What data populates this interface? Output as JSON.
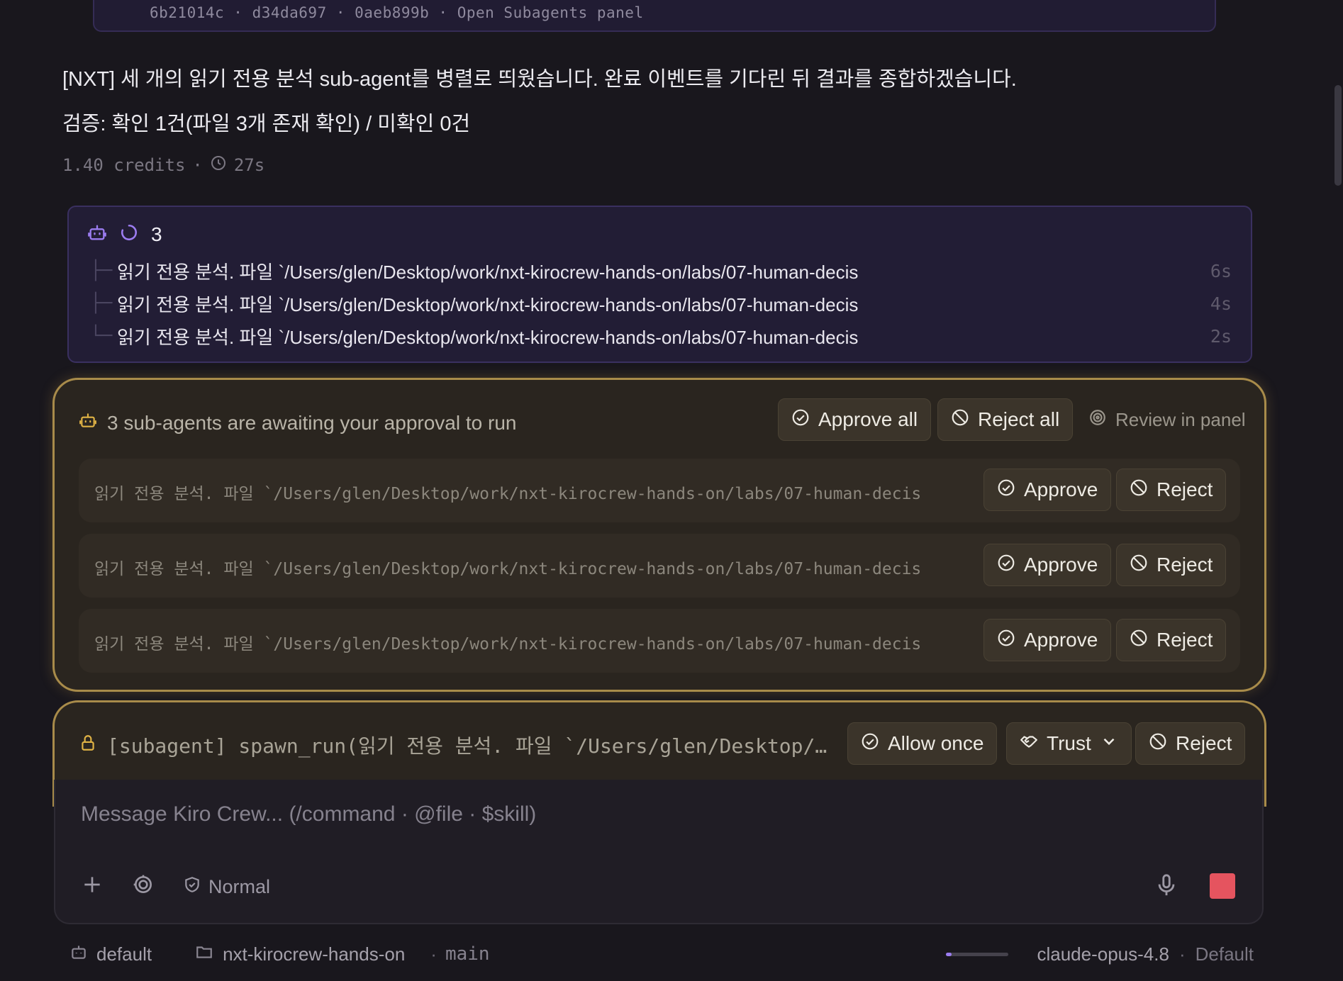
{
  "top_card": {
    "line": "6b21014c · d34da697 · 0aeb899b · Open Subagents panel"
  },
  "messages": {
    "line1": "[NXT] 세 개의 읽기 전용 분석 sub-agent를 병렬로 띄웠습니다. 완료 이벤트를 기다린 뒤 결과를 종합하겠습니다.",
    "line2": "검증: 확인 1건(파일 3개 존재 확인) / 미확인 0건",
    "credits": "1.40 credits",
    "sep": "·",
    "time": "27s"
  },
  "running": {
    "count": "3",
    "rows": [
      {
        "tree": "├─",
        "text": "읽기 전용 분석. 파일 `/Users/glen/Desktop/work/nxt-kirocrew-hands-on/labs/07-human-decis",
        "duration": "6s"
      },
      {
        "tree": "├─",
        "text": "읽기 전용 분석. 파일 `/Users/glen/Desktop/work/nxt-kirocrew-hands-on/labs/07-human-decis",
        "duration": "4s"
      },
      {
        "tree": "└─",
        "text": "읽기 전용 분석. 파일 `/Users/glen/Desktop/work/nxt-kirocrew-hands-on/labs/07-human-decis",
        "duration": "2s"
      }
    ]
  },
  "approval": {
    "title": "3 sub-agents are awaiting your approval to run",
    "approve_all": "Approve all",
    "reject_all": "Reject all",
    "review": "Review in panel",
    "rows": [
      {
        "text": "읽기 전용 분석. 파일 `/Users/glen/Desktop/work/nxt-kirocrew-hands-on/labs/07-human-decis",
        "approve": "Approve",
        "reject": "Reject"
      },
      {
        "text": "읽기 전용 분석. 파일 `/Users/glen/Desktop/work/nxt-kirocrew-hands-on/labs/07-human-decis",
        "approve": "Approve",
        "reject": "Reject"
      },
      {
        "text": "읽기 전용 분석. 파일 `/Users/glen/Desktop/work/nxt-kirocrew-hands-on/labs/07-human-decis",
        "approve": "Approve",
        "reject": "Reject"
      }
    ]
  },
  "permission": {
    "text": "[subagent] spawn_run(읽기 전용 분석. 파일 `/Users/glen/Desktop/…",
    "allow_once": "Allow once",
    "trust": "Trust",
    "reject": "Reject"
  },
  "composer": {
    "placeholder": "Message Kiro Crew... (/command · @file · $skill)",
    "mode": "Normal"
  },
  "status": {
    "agent": "default",
    "project": "nxt-kirocrew-hands-on",
    "sep": "·",
    "branch": "main",
    "model": "claude-opus-4.8",
    "profile": "Default"
  },
  "colors": {
    "accent_purple": "#9b7cf0",
    "accent_gold": "#a88b4a",
    "stop_red": "#e5545f"
  }
}
